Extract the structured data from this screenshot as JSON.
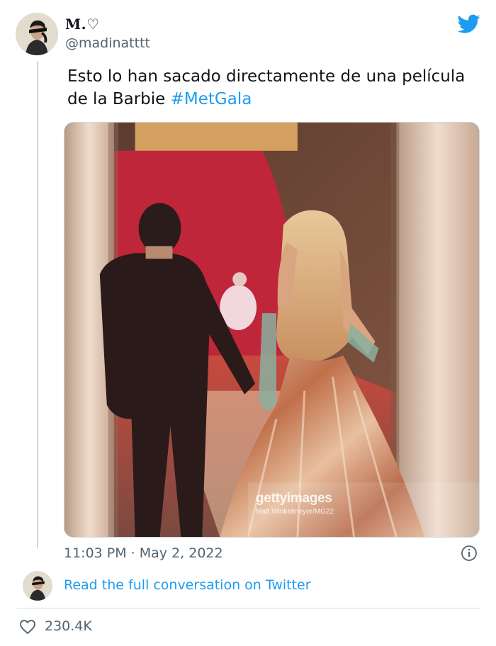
{
  "tweet": {
    "display_name": "M.♡",
    "handle": "@madinatttt",
    "text": "Esto lo han sacado directamente de una película de la Barbie ",
    "hashtag": "#MetGala",
    "timestamp": "11:03 PM · May 2, 2022",
    "read_full": "Read the full conversation on Twitter",
    "likes": "230.4K"
  },
  "photo": {
    "watermark_brand": "gettyimages",
    "watermark_credit": "Matt Winkelmeyer/MG22"
  },
  "colors": {
    "link": "#1d9bf0",
    "muted": "#536471",
    "text": "#0f1419",
    "border": "#cfd9de"
  },
  "icons": {
    "brand": "twitter-bird-icon",
    "info": "info-icon",
    "like": "heart-icon"
  }
}
